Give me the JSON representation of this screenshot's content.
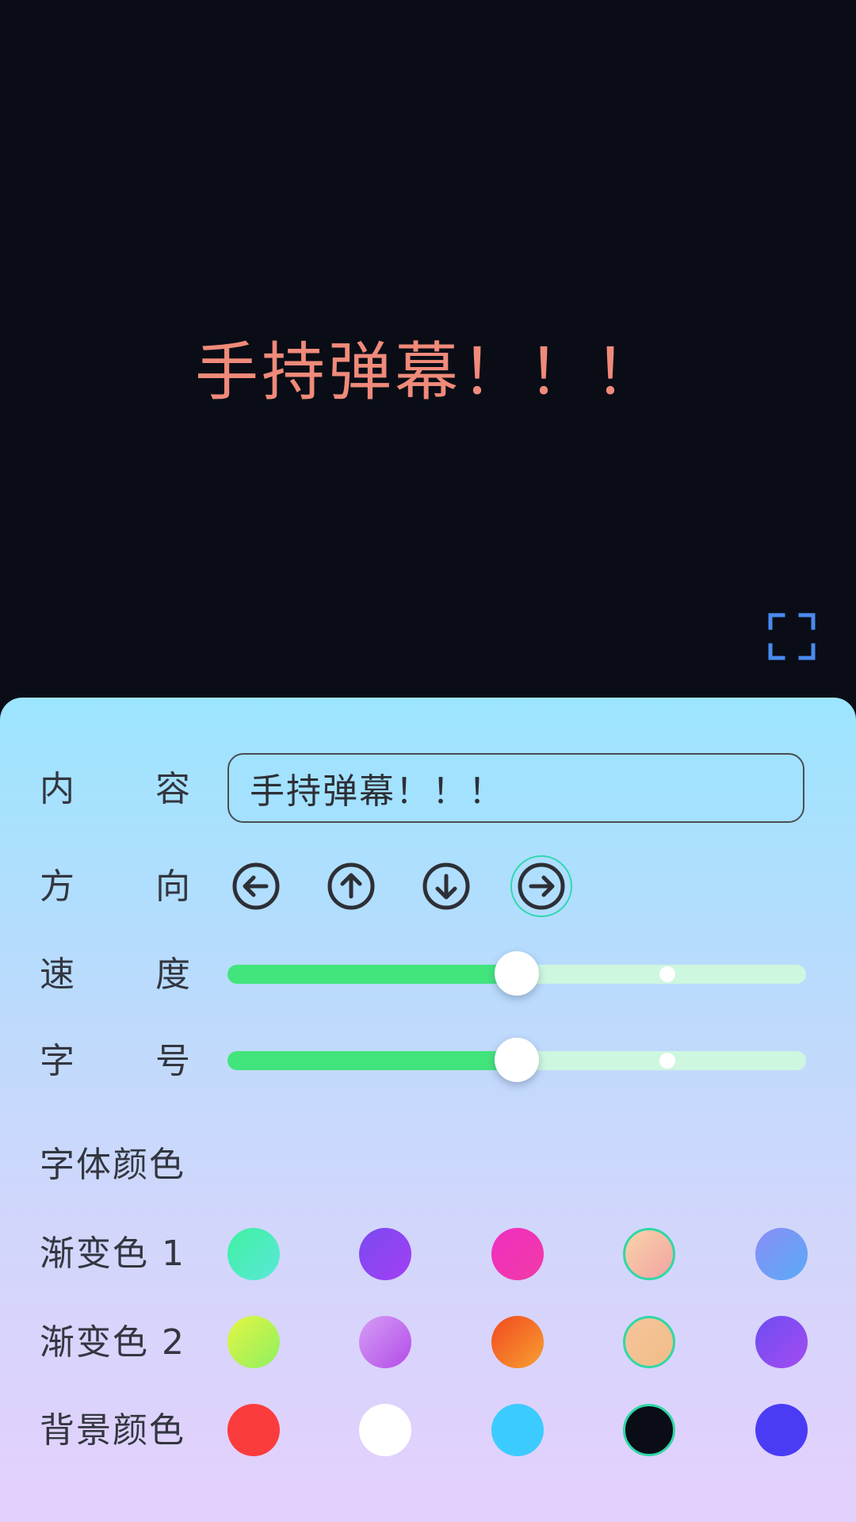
{
  "stage": {
    "danmaku_text": "手持弹幕！！！",
    "danmaku_color": "#f08a7a",
    "background_color": "#0a0d16",
    "fullscreen_icon": "fullscreen-corners-icon"
  },
  "panel": {
    "content": {
      "label_chars": [
        "内",
        "容"
      ],
      "value": "手持弹幕！！！"
    },
    "direction": {
      "label_chars": [
        "方",
        "向"
      ],
      "options": [
        {
          "icon": "arrow-left-circle-icon",
          "selected": false
        },
        {
          "icon": "arrow-up-circle-icon",
          "selected": false
        },
        {
          "icon": "arrow-down-circle-icon",
          "selected": false
        },
        {
          "icon": "arrow-right-circle-icon",
          "selected": true
        }
      ]
    },
    "speed": {
      "label_chars": [
        "速",
        "度"
      ],
      "value": 0.5,
      "mark": 0.76
    },
    "font_size": {
      "label_chars": [
        "字",
        "号"
      ],
      "value": 0.5,
      "mark": 0.76
    },
    "font_color_heading": "字体颜色",
    "gradient1": {
      "label": "渐变色 1",
      "swatches": [
        {
          "color": "linear-gradient(135deg,#3ff0a0,#5ae8d8)",
          "selected": false
        },
        {
          "color": "linear-gradient(135deg,#7a4af0,#a23ff5)",
          "selected": false
        },
        {
          "color": "linear-gradient(135deg,#ee2fc0,#f23aa8)",
          "selected": false
        },
        {
          "color": "linear-gradient(135deg,#f9d4a8,#f2a3a3)",
          "selected": true
        },
        {
          "color": "linear-gradient(135deg,#8a8ef5,#5aaaf8)",
          "selected": false
        }
      ]
    },
    "gradient2": {
      "label": "渐变色 2",
      "swatches": [
        {
          "color": "linear-gradient(135deg,#e4f542,#8ef060)",
          "selected": false
        },
        {
          "color": "linear-gradient(135deg,#d59ef5,#b34be8)",
          "selected": false
        },
        {
          "color": "linear-gradient(135deg,#f2491e,#f7a032)",
          "selected": false
        },
        {
          "color": "linear-gradient(135deg,#f6c49c,#f0bd86)",
          "selected": true
        },
        {
          "color": "linear-gradient(135deg,#6d4cf2,#a44cf0)",
          "selected": false
        }
      ]
    },
    "background": {
      "label": "背景颜色",
      "swatches": [
        {
          "color": "#fb3c3c",
          "selected": false
        },
        {
          "color": "#ffffff",
          "selected": false
        },
        {
          "color": "#3ccbff",
          "selected": false
        },
        {
          "color": "#0a0d16",
          "selected": true
        },
        {
          "color": "#4a3cf5",
          "selected": false
        }
      ]
    }
  }
}
